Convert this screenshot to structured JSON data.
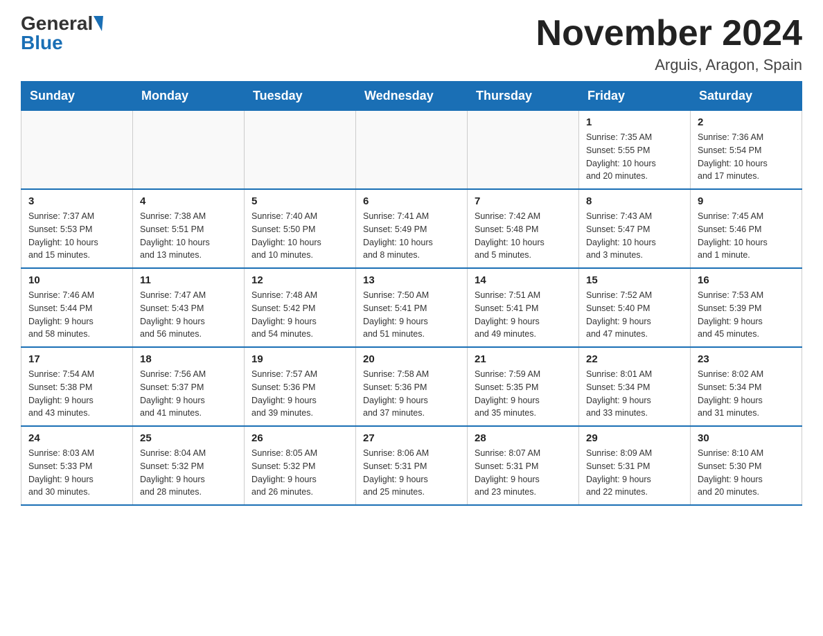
{
  "logo": {
    "general": "General",
    "blue": "Blue"
  },
  "header": {
    "month_title": "November 2024",
    "location": "Arguis, Aragon, Spain"
  },
  "weekdays": [
    "Sunday",
    "Monday",
    "Tuesday",
    "Wednesday",
    "Thursday",
    "Friday",
    "Saturday"
  ],
  "weeks": [
    [
      {
        "day": "",
        "info": ""
      },
      {
        "day": "",
        "info": ""
      },
      {
        "day": "",
        "info": ""
      },
      {
        "day": "",
        "info": ""
      },
      {
        "day": "",
        "info": ""
      },
      {
        "day": "1",
        "info": "Sunrise: 7:35 AM\nSunset: 5:55 PM\nDaylight: 10 hours\nand 20 minutes."
      },
      {
        "day": "2",
        "info": "Sunrise: 7:36 AM\nSunset: 5:54 PM\nDaylight: 10 hours\nand 17 minutes."
      }
    ],
    [
      {
        "day": "3",
        "info": "Sunrise: 7:37 AM\nSunset: 5:53 PM\nDaylight: 10 hours\nand 15 minutes."
      },
      {
        "day": "4",
        "info": "Sunrise: 7:38 AM\nSunset: 5:51 PM\nDaylight: 10 hours\nand 13 minutes."
      },
      {
        "day": "5",
        "info": "Sunrise: 7:40 AM\nSunset: 5:50 PM\nDaylight: 10 hours\nand 10 minutes."
      },
      {
        "day": "6",
        "info": "Sunrise: 7:41 AM\nSunset: 5:49 PM\nDaylight: 10 hours\nand 8 minutes."
      },
      {
        "day": "7",
        "info": "Sunrise: 7:42 AM\nSunset: 5:48 PM\nDaylight: 10 hours\nand 5 minutes."
      },
      {
        "day": "8",
        "info": "Sunrise: 7:43 AM\nSunset: 5:47 PM\nDaylight: 10 hours\nand 3 minutes."
      },
      {
        "day": "9",
        "info": "Sunrise: 7:45 AM\nSunset: 5:46 PM\nDaylight: 10 hours\nand 1 minute."
      }
    ],
    [
      {
        "day": "10",
        "info": "Sunrise: 7:46 AM\nSunset: 5:44 PM\nDaylight: 9 hours\nand 58 minutes."
      },
      {
        "day": "11",
        "info": "Sunrise: 7:47 AM\nSunset: 5:43 PM\nDaylight: 9 hours\nand 56 minutes."
      },
      {
        "day": "12",
        "info": "Sunrise: 7:48 AM\nSunset: 5:42 PM\nDaylight: 9 hours\nand 54 minutes."
      },
      {
        "day": "13",
        "info": "Sunrise: 7:50 AM\nSunset: 5:41 PM\nDaylight: 9 hours\nand 51 minutes."
      },
      {
        "day": "14",
        "info": "Sunrise: 7:51 AM\nSunset: 5:41 PM\nDaylight: 9 hours\nand 49 minutes."
      },
      {
        "day": "15",
        "info": "Sunrise: 7:52 AM\nSunset: 5:40 PM\nDaylight: 9 hours\nand 47 minutes."
      },
      {
        "day": "16",
        "info": "Sunrise: 7:53 AM\nSunset: 5:39 PM\nDaylight: 9 hours\nand 45 minutes."
      }
    ],
    [
      {
        "day": "17",
        "info": "Sunrise: 7:54 AM\nSunset: 5:38 PM\nDaylight: 9 hours\nand 43 minutes."
      },
      {
        "day": "18",
        "info": "Sunrise: 7:56 AM\nSunset: 5:37 PM\nDaylight: 9 hours\nand 41 minutes."
      },
      {
        "day": "19",
        "info": "Sunrise: 7:57 AM\nSunset: 5:36 PM\nDaylight: 9 hours\nand 39 minutes."
      },
      {
        "day": "20",
        "info": "Sunrise: 7:58 AM\nSunset: 5:36 PM\nDaylight: 9 hours\nand 37 minutes."
      },
      {
        "day": "21",
        "info": "Sunrise: 7:59 AM\nSunset: 5:35 PM\nDaylight: 9 hours\nand 35 minutes."
      },
      {
        "day": "22",
        "info": "Sunrise: 8:01 AM\nSunset: 5:34 PM\nDaylight: 9 hours\nand 33 minutes."
      },
      {
        "day": "23",
        "info": "Sunrise: 8:02 AM\nSunset: 5:34 PM\nDaylight: 9 hours\nand 31 minutes."
      }
    ],
    [
      {
        "day": "24",
        "info": "Sunrise: 8:03 AM\nSunset: 5:33 PM\nDaylight: 9 hours\nand 30 minutes."
      },
      {
        "day": "25",
        "info": "Sunrise: 8:04 AM\nSunset: 5:32 PM\nDaylight: 9 hours\nand 28 minutes."
      },
      {
        "day": "26",
        "info": "Sunrise: 8:05 AM\nSunset: 5:32 PM\nDaylight: 9 hours\nand 26 minutes."
      },
      {
        "day": "27",
        "info": "Sunrise: 8:06 AM\nSunset: 5:31 PM\nDaylight: 9 hours\nand 25 minutes."
      },
      {
        "day": "28",
        "info": "Sunrise: 8:07 AM\nSunset: 5:31 PM\nDaylight: 9 hours\nand 23 minutes."
      },
      {
        "day": "29",
        "info": "Sunrise: 8:09 AM\nSunset: 5:31 PM\nDaylight: 9 hours\nand 22 minutes."
      },
      {
        "day": "30",
        "info": "Sunrise: 8:10 AM\nSunset: 5:30 PM\nDaylight: 9 hours\nand 20 minutes."
      }
    ]
  ]
}
